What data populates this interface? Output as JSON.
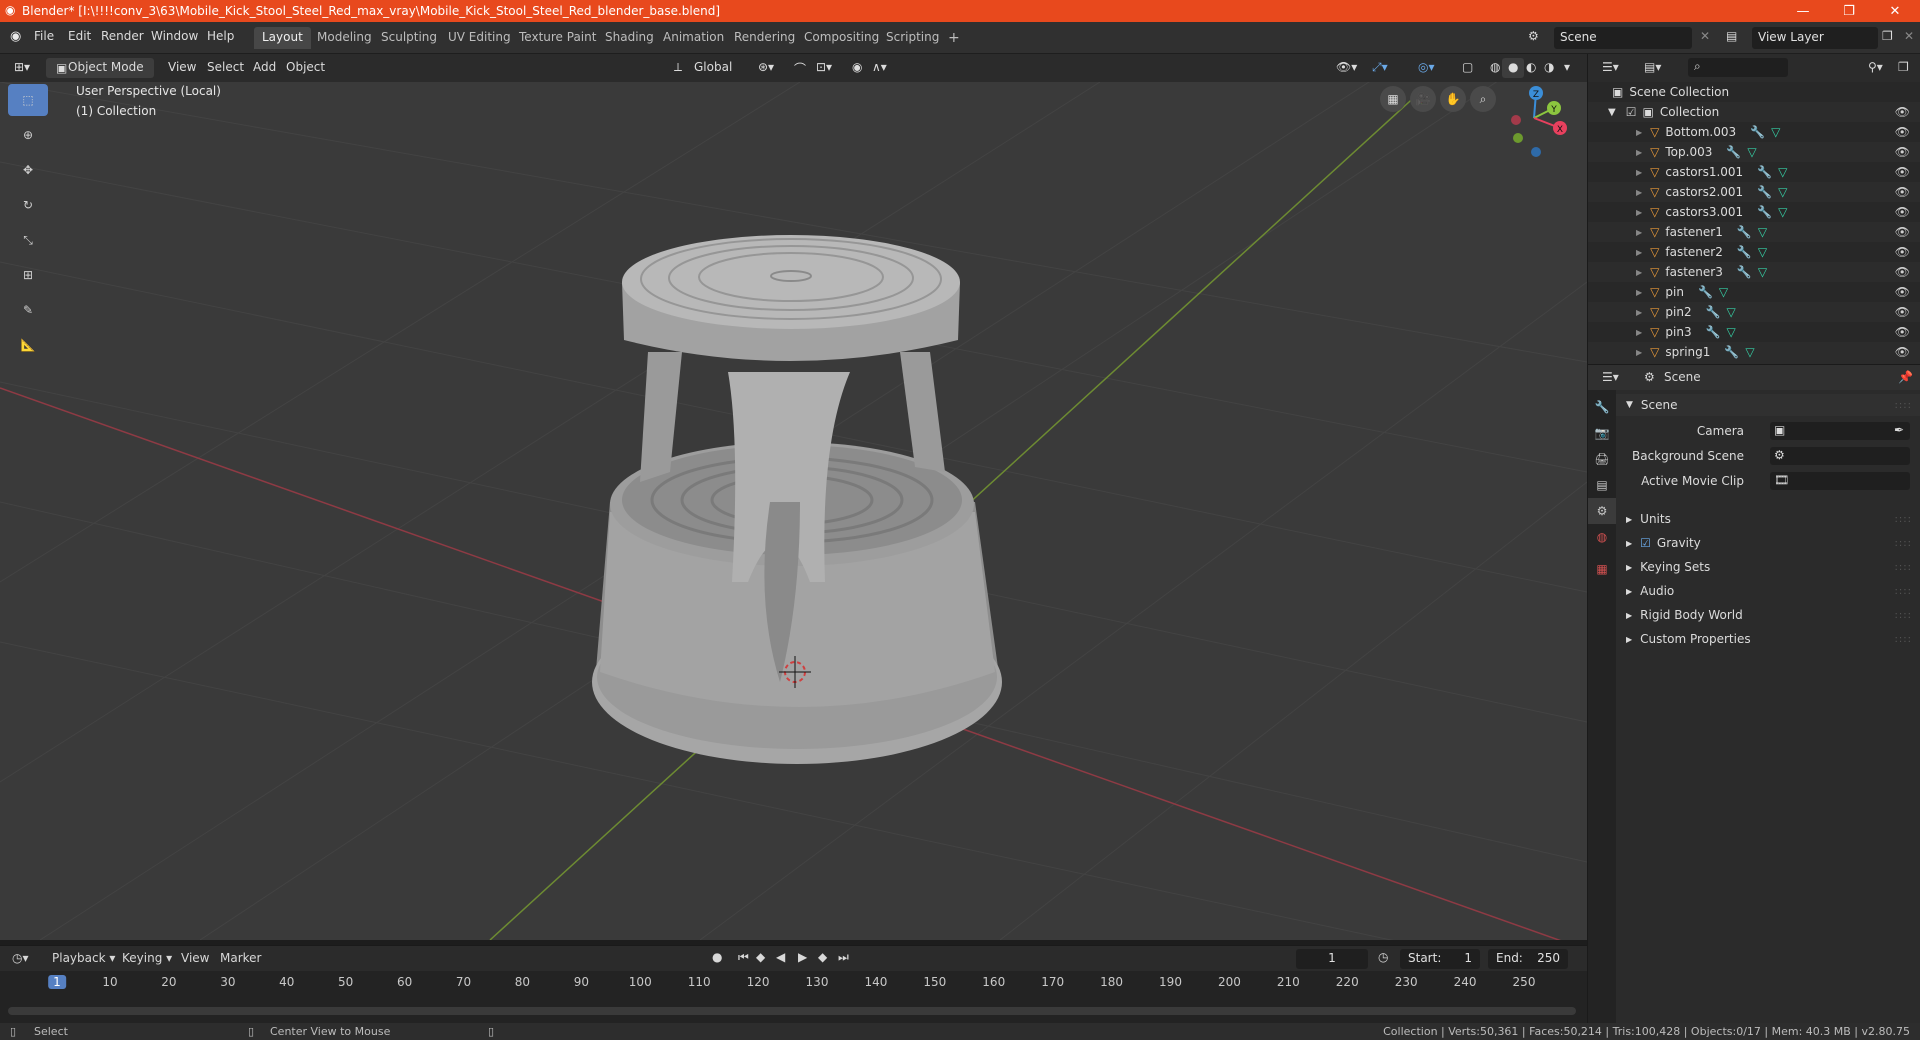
{
  "window": {
    "title": "Blender* [I:\\!!!!conv_3\\63\\Mobile_Kick_Stool_Steel_Red_max_vray\\Mobile_Kick_Stool_Steel_Red_blender_base.blend]",
    "title_color": "#e8491d"
  },
  "menu": [
    "File",
    "Edit",
    "Render",
    "Window",
    "Help"
  ],
  "workspaces": [
    "Layout",
    "Modeling",
    "Sculpting",
    "UV Editing",
    "Texture Paint",
    "Shading",
    "Animation",
    "Rendering",
    "Compositing",
    "Scripting"
  ],
  "workspace_add": "+",
  "scene_field": "Scene",
  "view_layer_field": "View Layer",
  "viewport_header": {
    "mode": "Object Mode",
    "menus": [
      "View",
      "Select",
      "Add",
      "Object"
    ],
    "orientation": "Global"
  },
  "viewport": {
    "perspective": "User Perspective (Local)",
    "collection": "(1) Collection",
    "gizmo_axes": {
      "x": "X",
      "y": "Y",
      "z": "Z"
    },
    "axis_colors": {
      "x": "#e8405e",
      "y": "#8cc63f",
      "z": "#3b8ed8"
    }
  },
  "outliner": {
    "root": "Scene Collection",
    "collection": "Collection",
    "objects": [
      "Bottom.003",
      "Top.003",
      "castors1.001",
      "castors2.001",
      "castors3.001",
      "fastener1",
      "fastener2",
      "fastener3",
      "pin",
      "pin2",
      "pin3",
      "spring1"
    ]
  },
  "properties": {
    "header": "Scene",
    "section": "Scene",
    "camera_label": "Camera",
    "background_scene_label": "Background Scene",
    "active_movie_clip_label": "Active Movie Clip",
    "panels": [
      "Units",
      "Gravity",
      "Keying Sets",
      "Audio",
      "Rigid Body World",
      "Custom Properties"
    ]
  },
  "timeline": {
    "menus": [
      "Playback",
      "Keying",
      "View",
      "Marker"
    ],
    "current_frame": "1",
    "start_label": "Start:",
    "start": "1",
    "end_label": "End:",
    "end": "250",
    "ticks": [
      "1",
      "10",
      "20",
      "30",
      "40",
      "50",
      "60",
      "70",
      "80",
      "90",
      "100",
      "110",
      "120",
      "130",
      "140",
      "150",
      "160",
      "170",
      "180",
      "190",
      "200",
      "210",
      "220",
      "230",
      "240",
      "250"
    ]
  },
  "status": {
    "left1": "Select",
    "left2": "Center View to Mouse",
    "right": "Collection | Verts:50,361 | Faces:50,214 | Tris:100,428 | Objects:0/17 | Mem: 40.3 MB | v2.80.75"
  }
}
